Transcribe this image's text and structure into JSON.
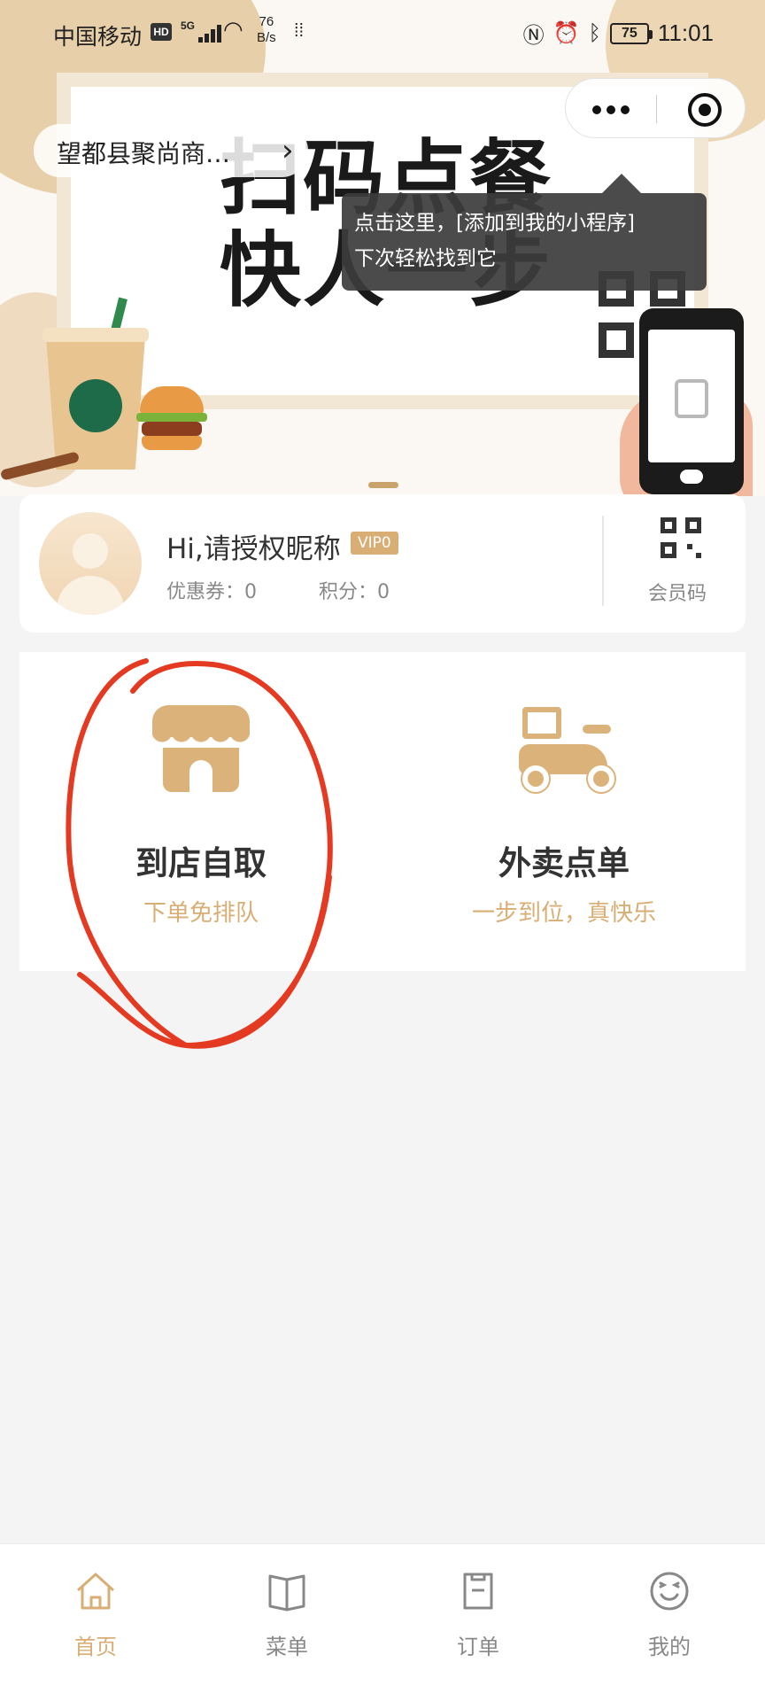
{
  "status_bar": {
    "carrier": "中国移动",
    "hd": "HD",
    "network": "5G",
    "speed_value": "76",
    "speed_unit": "B/s",
    "battery": "75",
    "time": "11:01"
  },
  "header": {
    "store_name": "望都县聚尚商…",
    "banner_line1": "扫码点餐",
    "banner_line2": "快人一步"
  },
  "tooltip": {
    "line1": "点击这里，[添加到我的小程序]",
    "line2": "下次轻松找到它"
  },
  "member": {
    "greeting": "Hi,请授权昵称",
    "vip_badge": "VIP0",
    "coupon_text": "优惠券：0",
    "points_text": "积分：0",
    "member_code_label": "会员码"
  },
  "options": {
    "pickup": {
      "title": "到店自取",
      "subtitle": "下单免排队"
    },
    "delivery": {
      "title": "外卖点单",
      "subtitle": "一步到位，真快乐"
    }
  },
  "tabbar": {
    "items": [
      {
        "label": "首页",
        "icon": "home-icon",
        "active": true
      },
      {
        "label": "菜单",
        "icon": "menu-book-icon",
        "active": false
      },
      {
        "label": "订单",
        "icon": "order-icon",
        "active": false
      },
      {
        "label": "我的",
        "icon": "profile-smile-icon",
        "active": false
      }
    ]
  },
  "colors": {
    "accent": "#d8ae75",
    "annotation_red": "#e53a22",
    "page_bg": "#f4f4f4"
  }
}
